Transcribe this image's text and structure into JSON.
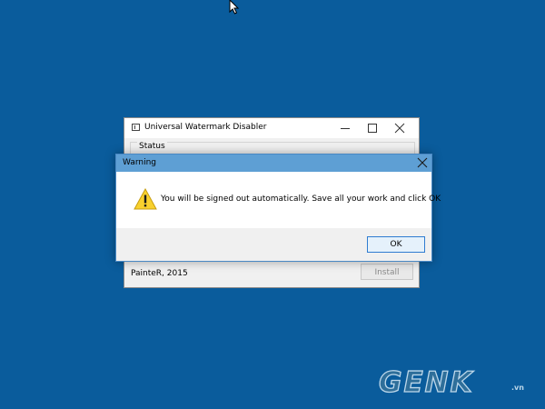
{
  "desktop": {
    "background_color": "#0a5c9c"
  },
  "app_window": {
    "title": "Universal Watermark Disabler",
    "status_label": "Status",
    "author": "PainteR, 2015",
    "install_label": "Install"
  },
  "dialog": {
    "title": "Warning",
    "message": "You will be signed out automatically. Save all your work and click OK",
    "ok_label": "OK",
    "icon": "warning-icon"
  },
  "watermark": {
    "text": "GENK",
    "suffix": ".vn"
  }
}
